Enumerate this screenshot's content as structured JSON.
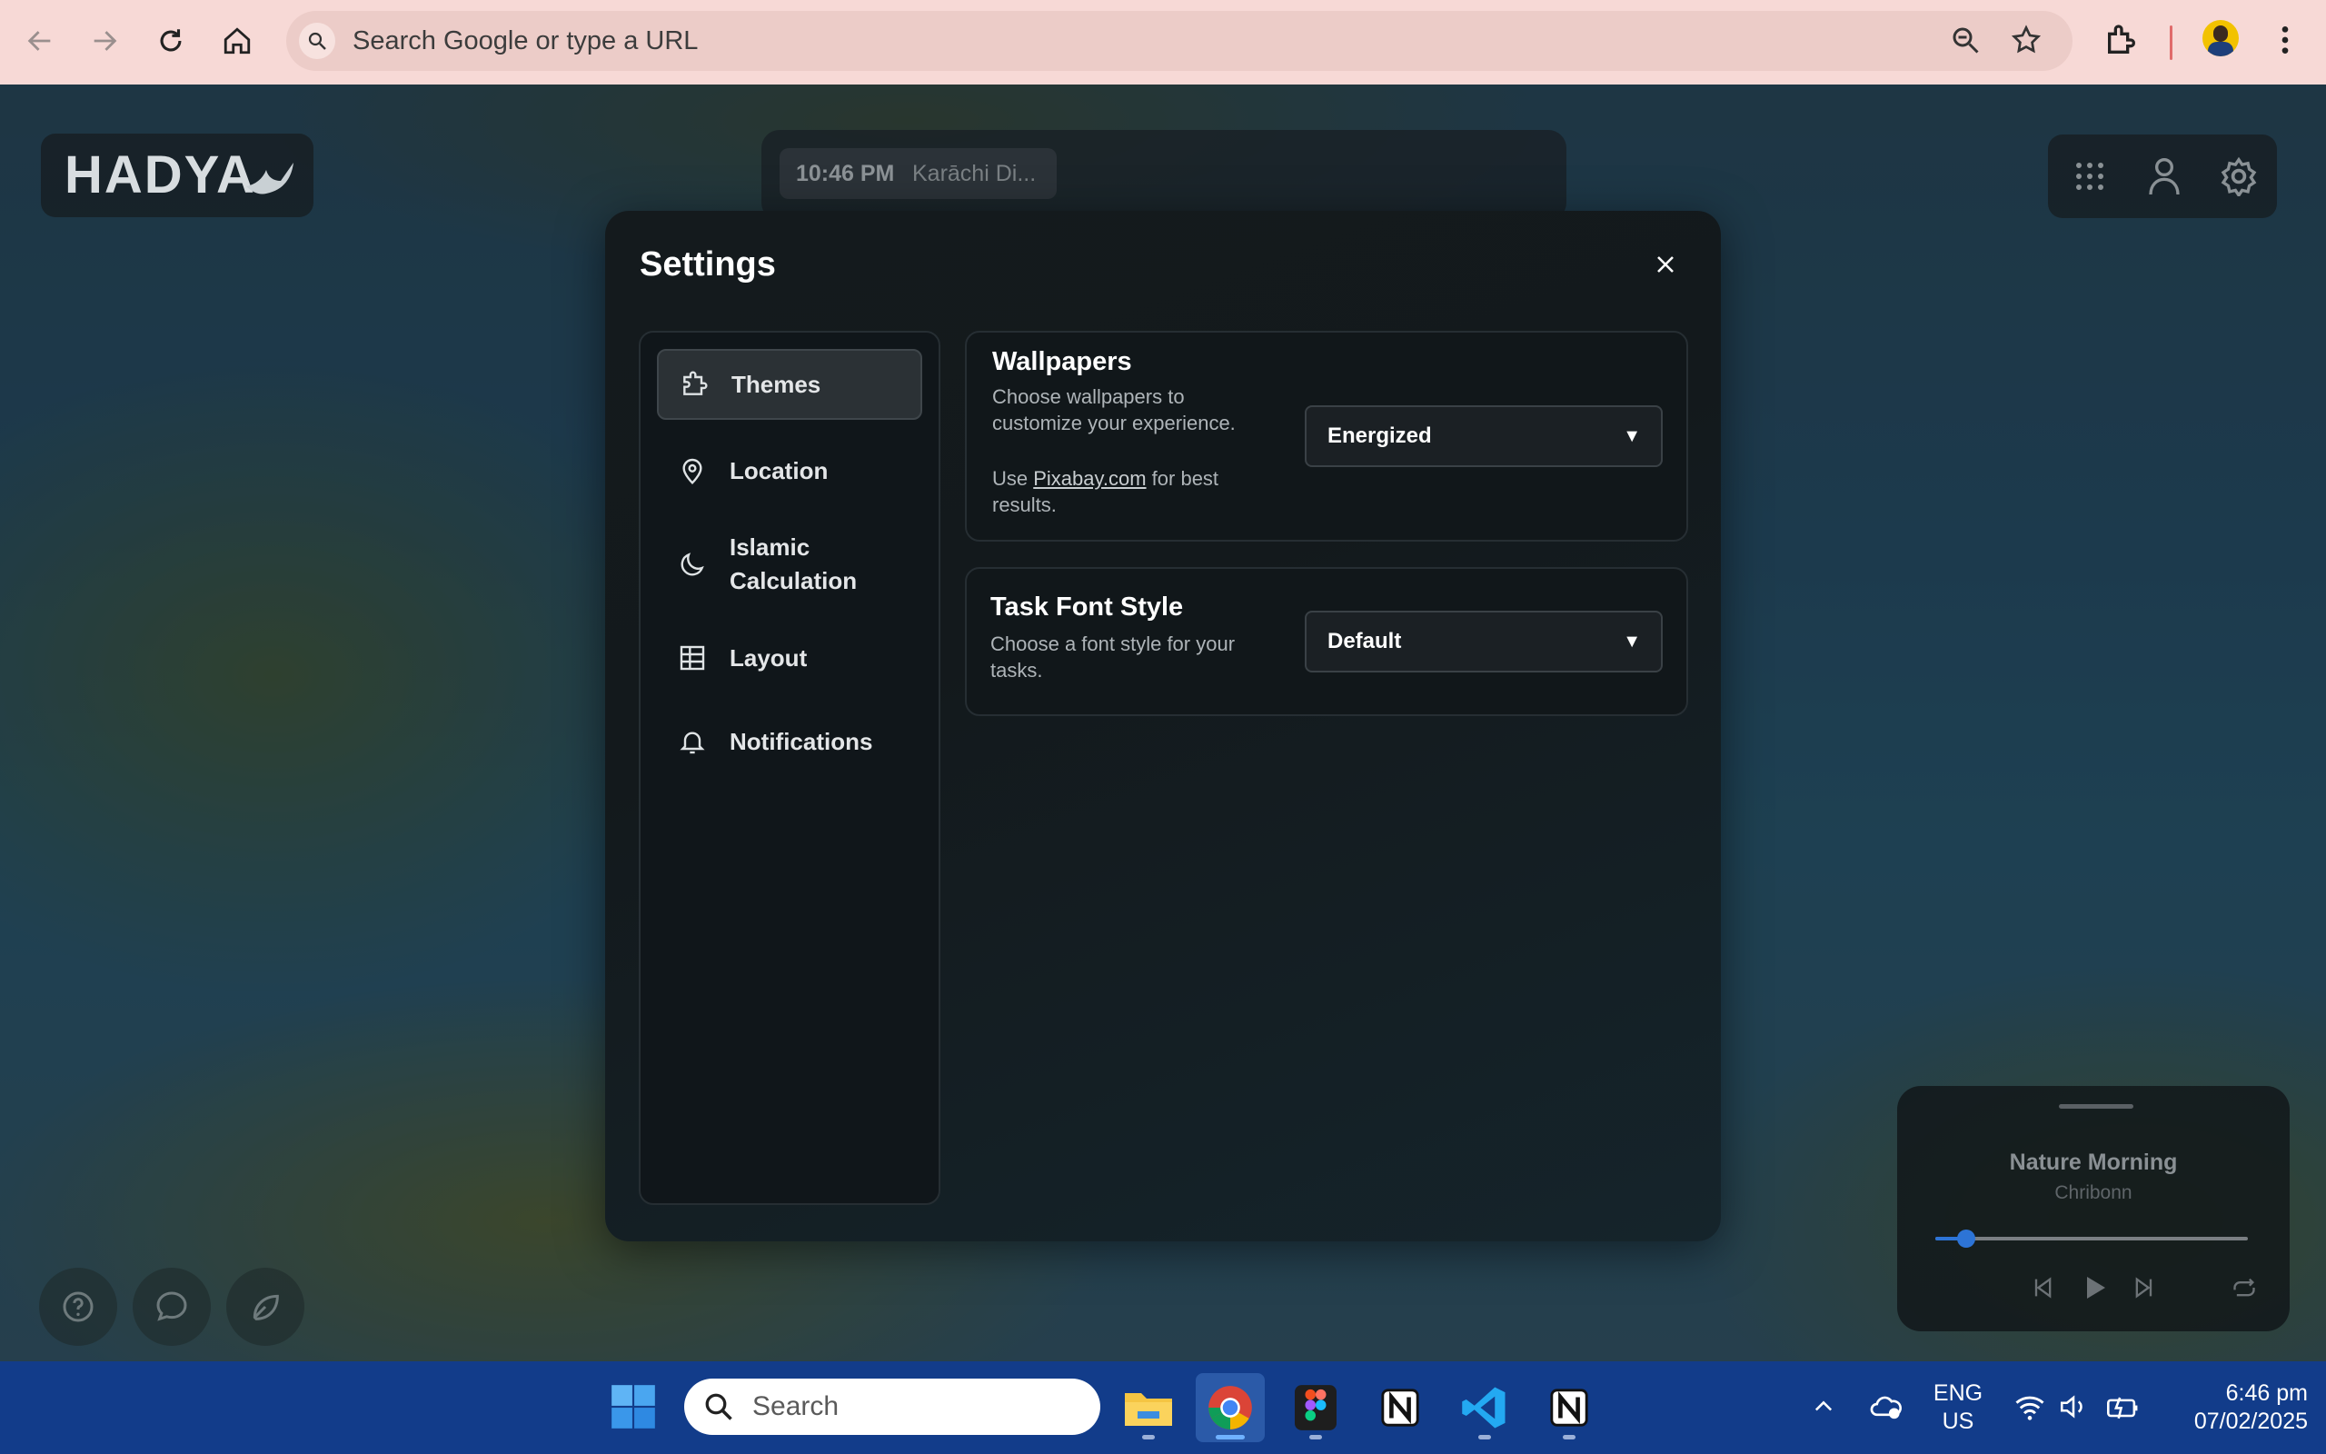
{
  "browser": {
    "omnibox_placeholder": "Search Google or type a URL"
  },
  "logo": {
    "text": "HADYA"
  },
  "clock": {
    "time": "10:46 PM",
    "location": "Karāchi Di..."
  },
  "settings": {
    "title": "Settings",
    "nav": [
      {
        "label": "Themes",
        "icon": "puzzle-icon",
        "active": true
      },
      {
        "label": "Location",
        "icon": "map-pin-icon"
      },
      {
        "label": "Islamic Calculation",
        "icon": "moon-icon"
      },
      {
        "label": "Layout",
        "icon": "grid-table-icon"
      },
      {
        "label": "Notifications",
        "icon": "bell-icon"
      }
    ],
    "wallpapers": {
      "title": "Wallpapers",
      "desc": "Choose wallpapers to customize your experience.",
      "use_prefix": "Use ",
      "link": "Pixabay.com",
      "use_suffix": " for best results.",
      "value": "Energized"
    },
    "font_style": {
      "title": "Task Font Style",
      "desc": "Choose a font style for your tasks.",
      "value": "Default"
    }
  },
  "player": {
    "song": "Nature Morning",
    "artist": "Chribonn",
    "progress": 0.1
  },
  "taskbar": {
    "search_placeholder": "Search",
    "lang_top": "ENG",
    "lang_bottom": "US",
    "time": "6:46 pm",
    "date": "07/02/2025"
  },
  "colors": {
    "chrome": "#f7d9d6",
    "taskbar": "#123c8a",
    "accent": "#2d74d6"
  }
}
